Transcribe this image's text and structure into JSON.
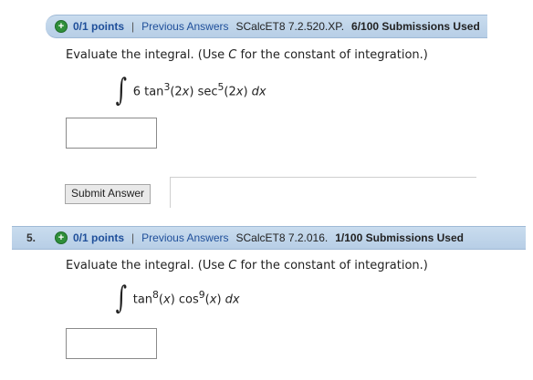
{
  "q4": {
    "points": "0/1 points",
    "separator": "|",
    "prev_link": "Previous Answers",
    "code": "SCalcET8 7.2.520.XP.",
    "submissions": "6/100 Submissions Used",
    "prompt_a": "Evaluate the integral. (Use ",
    "prompt_c": "C",
    "prompt_b": " for the constant of integration.)",
    "expr": {
      "coef": "6 tan",
      "exp1": "3",
      "mid": "(2",
      "x1": "x",
      "mid2": ") sec",
      "exp2": "5",
      "mid3": "(2",
      "x2": "x",
      "end": ") ",
      "dx": "dx"
    },
    "answer_value": "",
    "submit_label": "Submit Answer"
  },
  "q5": {
    "number": "5.",
    "points": "0/1 points",
    "separator": "|",
    "prev_link": "Previous Answers",
    "code": "SCalcET8 7.2.016.",
    "submissions": "1/100 Submissions Used",
    "prompt_a": "Evaluate the integral. (Use ",
    "prompt_c": "C",
    "prompt_b": " for the constant of integration.)",
    "expr": {
      "f1": "tan",
      "exp1": "8",
      "paren1": "(",
      "x1": "x",
      "close1": ") cos",
      "exp2": "9",
      "paren2": "(",
      "x2": "x",
      "close2": ") ",
      "dx": "dx"
    },
    "answer_value": ""
  },
  "icons": {
    "points_icon": "plus-circle-icon",
    "integral": "integral-sign"
  },
  "colors": {
    "bar": "#c9dcee",
    "link": "#1f4f9a",
    "plus": "#2f8f3a"
  }
}
